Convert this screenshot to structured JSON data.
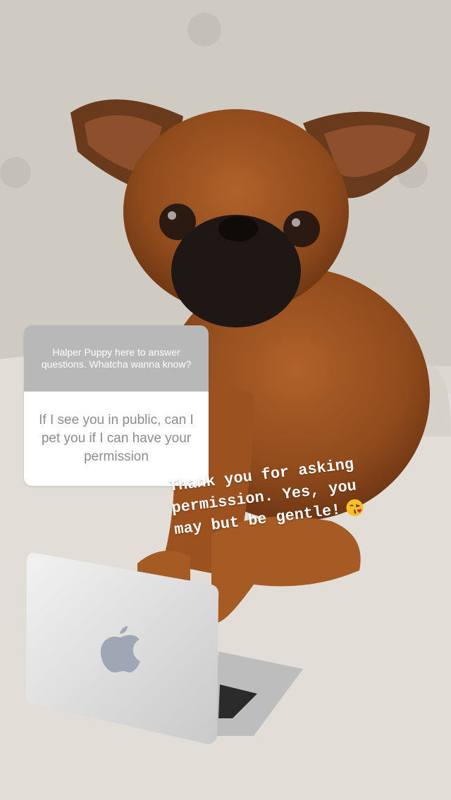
{
  "question_sticker": {
    "prompt": "Halper Puppy here to answer questions. Whatcha wanna know?",
    "question": "If I see you in public, can I pet you if I can have your permission",
    "header_color": "#b8b8b8",
    "body_color": "#ffffff"
  },
  "answer_text": {
    "line1": "Thank you for asking",
    "line2": "permission. Yes, you",
    "line3": "may but be gentle!",
    "emoji": "kissing-face-with-heart-emoji"
  },
  "photo": {
    "subject": "dog-with-laptop-photo",
    "icon": "apple-logo-icon"
  }
}
